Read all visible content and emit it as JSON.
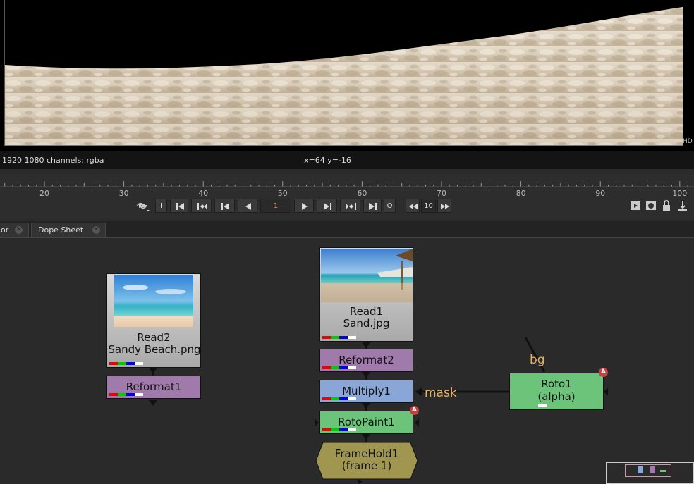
{
  "viewer": {
    "format_label": "HD",
    "info_left": "1920 1080 channels: rgba",
    "info_coords": "x=64 y=-16"
  },
  "timeline": {
    "ticks": [
      "20",
      "30",
      "40",
      "50",
      "60",
      "70",
      "80",
      "90",
      "100"
    ],
    "current_frame": "1",
    "step": "10",
    "buttons": {
      "in_point": "I",
      "out_point": "O"
    }
  },
  "tabs": [
    {
      "label": "or"
    },
    {
      "label": "Dope Sheet"
    }
  ],
  "nodes": {
    "read2": {
      "line1": "Read2",
      "line2": "Sandy Beach.png"
    },
    "reformat1": {
      "label": "Reformat1"
    },
    "read1": {
      "line1": "Read1",
      "line2": "Sand.jpg"
    },
    "reformat2": {
      "label": "Reformat2"
    },
    "multiply1": {
      "label": "Multiply1"
    },
    "rotopaint1": {
      "label": "RotoPaint1"
    },
    "framehold1": {
      "line1": "FrameHold1",
      "line2": "(frame 1)"
    },
    "roto1": {
      "line1": "Roto1",
      "line2": "(alpha)"
    }
  },
  "edges": {
    "mask_label": "mask",
    "bg_label": "bg"
  },
  "badge_letter": "A",
  "colors": {
    "read_node": "#c8c8c8",
    "reformat_node": "#a07aaa",
    "multiply_node": "#8aa6d6",
    "roto_node": "#6cc47a",
    "framehold_node": "#a09650",
    "edge_label": "#e8b25c",
    "current_frame": "#e8962e"
  }
}
